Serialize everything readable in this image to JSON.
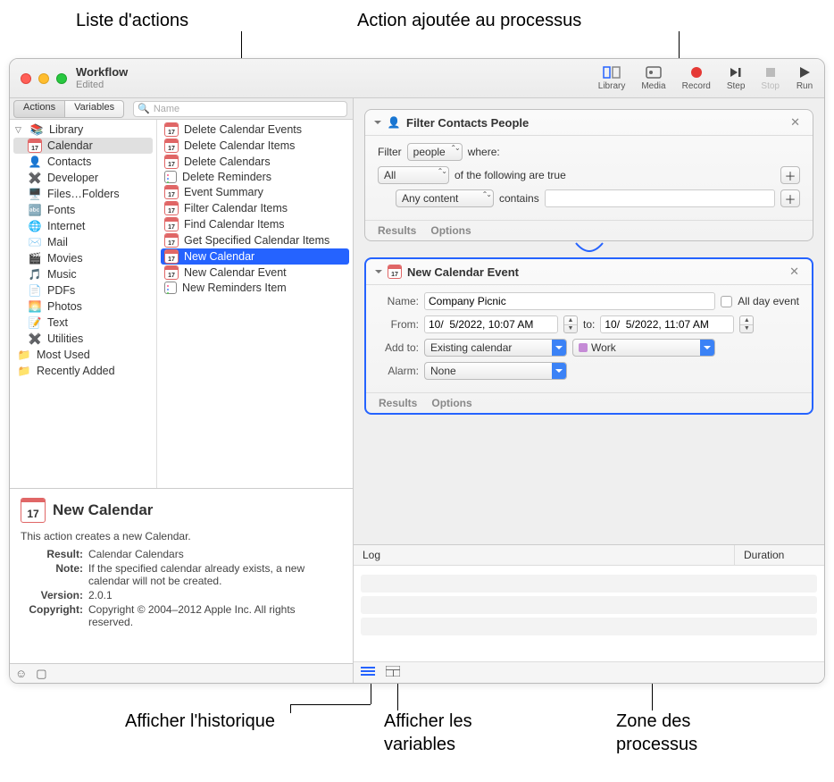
{
  "annotations": {
    "top_left": "Liste d'actions",
    "top_right": "Action ajoutée au processus",
    "bottom_1": "Afficher l'historique",
    "bottom_2": "Afficher les\nvariables",
    "bottom_3": "Zone des\nprocessus"
  },
  "window": {
    "title": "Workflow",
    "subtitle": "Edited"
  },
  "toolbar": {
    "library": "Library",
    "media": "Media",
    "record": "Record",
    "step": "Step",
    "stop": "Stop",
    "run": "Run"
  },
  "left_tabs": {
    "actions": "Actions",
    "variables": "Variables",
    "search_placeholder": "Name"
  },
  "categories_header": "Library",
  "categories": [
    {
      "label": "Calendar",
      "selected": true,
      "icon": "cal"
    },
    {
      "label": "Contacts",
      "icon": "contacts"
    },
    {
      "label": "Developer",
      "icon": "dev"
    },
    {
      "label": "Files…Folders",
      "icon": "finder"
    },
    {
      "label": "Fonts",
      "icon": "fonts"
    },
    {
      "label": "Internet",
      "icon": "internet"
    },
    {
      "label": "Mail",
      "icon": "mail"
    },
    {
      "label": "Movies",
      "icon": "movies"
    },
    {
      "label": "Music",
      "icon": "music"
    },
    {
      "label": "PDFs",
      "icon": "pdf"
    },
    {
      "label": "Photos",
      "icon": "photos"
    },
    {
      "label": "Text",
      "icon": "text"
    },
    {
      "label": "Utilities",
      "icon": "util"
    }
  ],
  "category_groups": [
    {
      "label": "Most Used",
      "icon": "group"
    },
    {
      "label": "Recently Added",
      "icon": "group"
    }
  ],
  "actions_list": [
    {
      "label": "Delete Calendar Events",
      "icon": "cal"
    },
    {
      "label": "Delete Calendar Items",
      "icon": "cal"
    },
    {
      "label": "Delete Calendars",
      "icon": "cal"
    },
    {
      "label": "Delete Reminders",
      "icon": "rem"
    },
    {
      "label": "Event Summary",
      "icon": "cal"
    },
    {
      "label": "Filter Calendar Items",
      "icon": "cal"
    },
    {
      "label": "Find Calendar Items",
      "icon": "cal"
    },
    {
      "label": "Get Specified Calendar Items",
      "icon": "cal"
    },
    {
      "label": "New Calendar",
      "icon": "cal",
      "selected": true
    },
    {
      "label": "New Calendar Event",
      "icon": "cal"
    },
    {
      "label": "New Reminders Item",
      "icon": "rem"
    }
  ],
  "description": {
    "title": "New Calendar",
    "body": "This action creates a new Calendar.",
    "result_label": "Result:",
    "result_val": "Calendar Calendars",
    "note_label": "Note:",
    "note_val": "If the specified calendar already exists, a new calendar will not be created.",
    "version_label": "Version:",
    "version_val": "2.0.1",
    "copyright_label": "Copyright:",
    "copyright_val": "Copyright © 2004–2012 Apple Inc.  All rights reserved."
  },
  "workflow": {
    "card1": {
      "title": "Filter Contacts People",
      "filter_label": "Filter",
      "filter_sel": "people",
      "filter_where": "where:",
      "all_sel": "All",
      "all_text": "of the following are true",
      "content_sel": "Any content",
      "contains": "contains",
      "results": "Results",
      "options": "Options"
    },
    "card2": {
      "title": "New Calendar Event",
      "name_label": "Name:",
      "name_val": "Company Picnic",
      "allday": "All day event",
      "from_label": "From:",
      "from_val": "10/  5/2022, 10:07 AM",
      "to_label": "to:",
      "to_val": "10/  5/2022, 11:07 AM",
      "addto_label": "Add to:",
      "addto_sel": "Existing calendar",
      "addto_cal": "Work",
      "alarm_label": "Alarm:",
      "alarm_sel": "None",
      "results": "Results",
      "options": "Options"
    }
  },
  "log": {
    "col_log": "Log",
    "col_dur": "Duration"
  }
}
